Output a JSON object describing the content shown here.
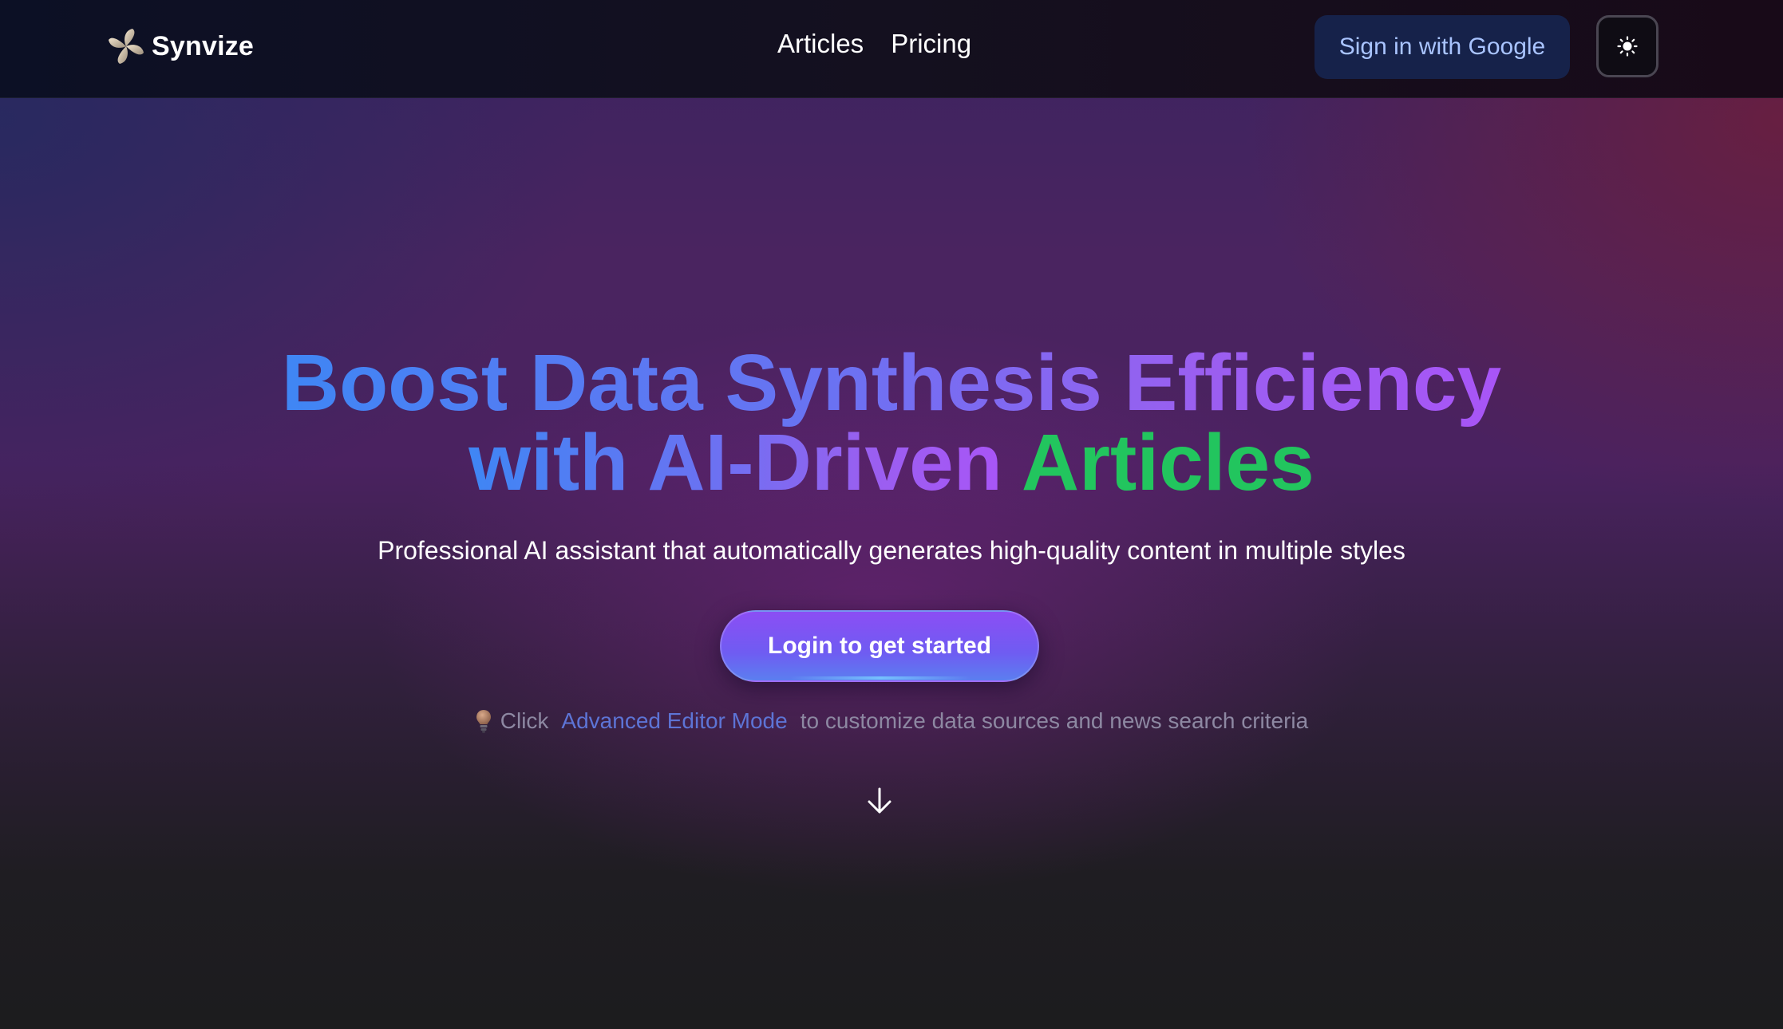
{
  "header": {
    "brand_name": "Synvize",
    "nav": {
      "articles": "Articles",
      "pricing": "Pricing"
    },
    "signin_label": "Sign in with Google",
    "theme_toggle_icon": "sun-icon"
  },
  "hero": {
    "title_line1": "Boost Data Synthesis Efficiency",
    "title_line2_main": "with AI-Driven",
    "title_line2_accent": "Articles",
    "subtitle": "Professional AI assistant that automatically generates high-quality content in multiple styles",
    "cta_label": "Login to get started",
    "tip": {
      "icon": "lightbulb-icon",
      "prefix": "Click",
      "link": "Advanced Editor Mode",
      "suffix": "to customize data sources and news search criteria"
    },
    "scroll_icon": "arrow-down-icon"
  },
  "colors": {
    "title_gradient_start": "#3f86f4",
    "title_gradient_end": "#a855f7",
    "title_accent": "#22c55e",
    "signin_bg": "#16224a",
    "signin_text": "#a9c4ff",
    "cta_start": "#8b4ef4",
    "cta_end": "#5b7ef0",
    "tip_link": "#5d74d6"
  }
}
